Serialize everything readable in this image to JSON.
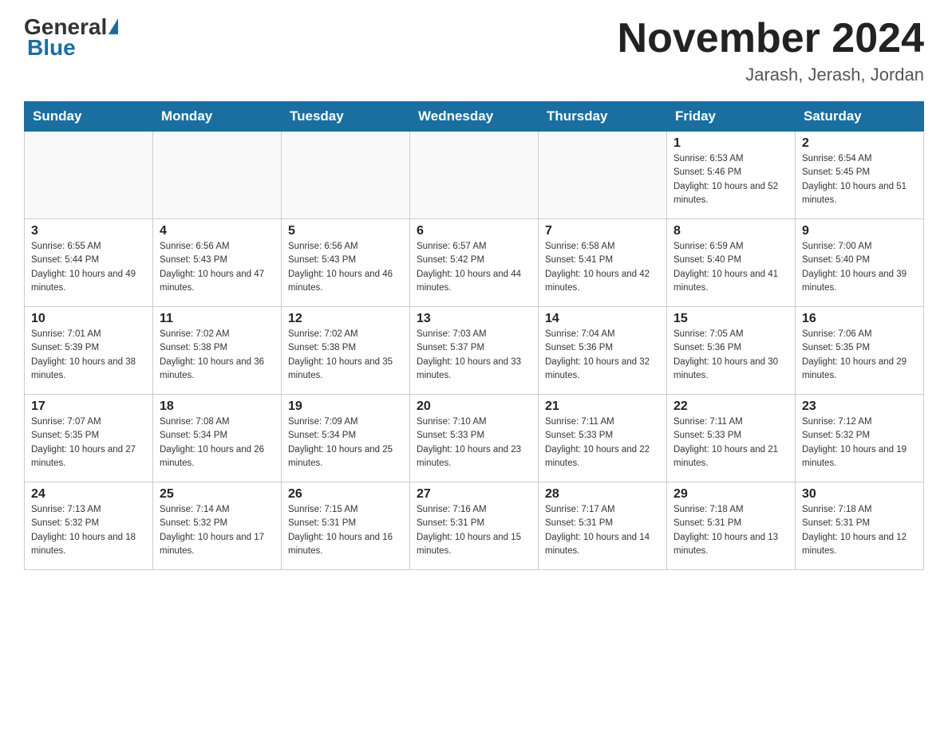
{
  "logo": {
    "general": "General",
    "blue": "Blue"
  },
  "title": "November 2024",
  "subtitle": "Jarash, Jerash, Jordan",
  "weekdays": [
    "Sunday",
    "Monday",
    "Tuesday",
    "Wednesday",
    "Thursday",
    "Friday",
    "Saturday"
  ],
  "weeks": [
    [
      {
        "day": "",
        "sunrise": "",
        "sunset": "",
        "daylight": ""
      },
      {
        "day": "",
        "sunrise": "",
        "sunset": "",
        "daylight": ""
      },
      {
        "day": "",
        "sunrise": "",
        "sunset": "",
        "daylight": ""
      },
      {
        "day": "",
        "sunrise": "",
        "sunset": "",
        "daylight": ""
      },
      {
        "day": "",
        "sunrise": "",
        "sunset": "",
        "daylight": ""
      },
      {
        "day": "1",
        "sunrise": "Sunrise: 6:53 AM",
        "sunset": "Sunset: 5:46 PM",
        "daylight": "Daylight: 10 hours and 52 minutes."
      },
      {
        "day": "2",
        "sunrise": "Sunrise: 6:54 AM",
        "sunset": "Sunset: 5:45 PM",
        "daylight": "Daylight: 10 hours and 51 minutes."
      }
    ],
    [
      {
        "day": "3",
        "sunrise": "Sunrise: 6:55 AM",
        "sunset": "Sunset: 5:44 PM",
        "daylight": "Daylight: 10 hours and 49 minutes."
      },
      {
        "day": "4",
        "sunrise": "Sunrise: 6:56 AM",
        "sunset": "Sunset: 5:43 PM",
        "daylight": "Daylight: 10 hours and 47 minutes."
      },
      {
        "day": "5",
        "sunrise": "Sunrise: 6:56 AM",
        "sunset": "Sunset: 5:43 PM",
        "daylight": "Daylight: 10 hours and 46 minutes."
      },
      {
        "day": "6",
        "sunrise": "Sunrise: 6:57 AM",
        "sunset": "Sunset: 5:42 PM",
        "daylight": "Daylight: 10 hours and 44 minutes."
      },
      {
        "day": "7",
        "sunrise": "Sunrise: 6:58 AM",
        "sunset": "Sunset: 5:41 PM",
        "daylight": "Daylight: 10 hours and 42 minutes."
      },
      {
        "day": "8",
        "sunrise": "Sunrise: 6:59 AM",
        "sunset": "Sunset: 5:40 PM",
        "daylight": "Daylight: 10 hours and 41 minutes."
      },
      {
        "day": "9",
        "sunrise": "Sunrise: 7:00 AM",
        "sunset": "Sunset: 5:40 PM",
        "daylight": "Daylight: 10 hours and 39 minutes."
      }
    ],
    [
      {
        "day": "10",
        "sunrise": "Sunrise: 7:01 AM",
        "sunset": "Sunset: 5:39 PM",
        "daylight": "Daylight: 10 hours and 38 minutes."
      },
      {
        "day": "11",
        "sunrise": "Sunrise: 7:02 AM",
        "sunset": "Sunset: 5:38 PM",
        "daylight": "Daylight: 10 hours and 36 minutes."
      },
      {
        "day": "12",
        "sunrise": "Sunrise: 7:02 AM",
        "sunset": "Sunset: 5:38 PM",
        "daylight": "Daylight: 10 hours and 35 minutes."
      },
      {
        "day": "13",
        "sunrise": "Sunrise: 7:03 AM",
        "sunset": "Sunset: 5:37 PM",
        "daylight": "Daylight: 10 hours and 33 minutes."
      },
      {
        "day": "14",
        "sunrise": "Sunrise: 7:04 AM",
        "sunset": "Sunset: 5:36 PM",
        "daylight": "Daylight: 10 hours and 32 minutes."
      },
      {
        "day": "15",
        "sunrise": "Sunrise: 7:05 AM",
        "sunset": "Sunset: 5:36 PM",
        "daylight": "Daylight: 10 hours and 30 minutes."
      },
      {
        "day": "16",
        "sunrise": "Sunrise: 7:06 AM",
        "sunset": "Sunset: 5:35 PM",
        "daylight": "Daylight: 10 hours and 29 minutes."
      }
    ],
    [
      {
        "day": "17",
        "sunrise": "Sunrise: 7:07 AM",
        "sunset": "Sunset: 5:35 PM",
        "daylight": "Daylight: 10 hours and 27 minutes."
      },
      {
        "day": "18",
        "sunrise": "Sunrise: 7:08 AM",
        "sunset": "Sunset: 5:34 PM",
        "daylight": "Daylight: 10 hours and 26 minutes."
      },
      {
        "day": "19",
        "sunrise": "Sunrise: 7:09 AM",
        "sunset": "Sunset: 5:34 PM",
        "daylight": "Daylight: 10 hours and 25 minutes."
      },
      {
        "day": "20",
        "sunrise": "Sunrise: 7:10 AM",
        "sunset": "Sunset: 5:33 PM",
        "daylight": "Daylight: 10 hours and 23 minutes."
      },
      {
        "day": "21",
        "sunrise": "Sunrise: 7:11 AM",
        "sunset": "Sunset: 5:33 PM",
        "daylight": "Daylight: 10 hours and 22 minutes."
      },
      {
        "day": "22",
        "sunrise": "Sunrise: 7:11 AM",
        "sunset": "Sunset: 5:33 PM",
        "daylight": "Daylight: 10 hours and 21 minutes."
      },
      {
        "day": "23",
        "sunrise": "Sunrise: 7:12 AM",
        "sunset": "Sunset: 5:32 PM",
        "daylight": "Daylight: 10 hours and 19 minutes."
      }
    ],
    [
      {
        "day": "24",
        "sunrise": "Sunrise: 7:13 AM",
        "sunset": "Sunset: 5:32 PM",
        "daylight": "Daylight: 10 hours and 18 minutes."
      },
      {
        "day": "25",
        "sunrise": "Sunrise: 7:14 AM",
        "sunset": "Sunset: 5:32 PM",
        "daylight": "Daylight: 10 hours and 17 minutes."
      },
      {
        "day": "26",
        "sunrise": "Sunrise: 7:15 AM",
        "sunset": "Sunset: 5:31 PM",
        "daylight": "Daylight: 10 hours and 16 minutes."
      },
      {
        "day": "27",
        "sunrise": "Sunrise: 7:16 AM",
        "sunset": "Sunset: 5:31 PM",
        "daylight": "Daylight: 10 hours and 15 minutes."
      },
      {
        "day": "28",
        "sunrise": "Sunrise: 7:17 AM",
        "sunset": "Sunset: 5:31 PM",
        "daylight": "Daylight: 10 hours and 14 minutes."
      },
      {
        "day": "29",
        "sunrise": "Sunrise: 7:18 AM",
        "sunset": "Sunset: 5:31 PM",
        "daylight": "Daylight: 10 hours and 13 minutes."
      },
      {
        "day": "30",
        "sunrise": "Sunrise: 7:18 AM",
        "sunset": "Sunset: 5:31 PM",
        "daylight": "Daylight: 10 hours and 12 minutes."
      }
    ]
  ]
}
